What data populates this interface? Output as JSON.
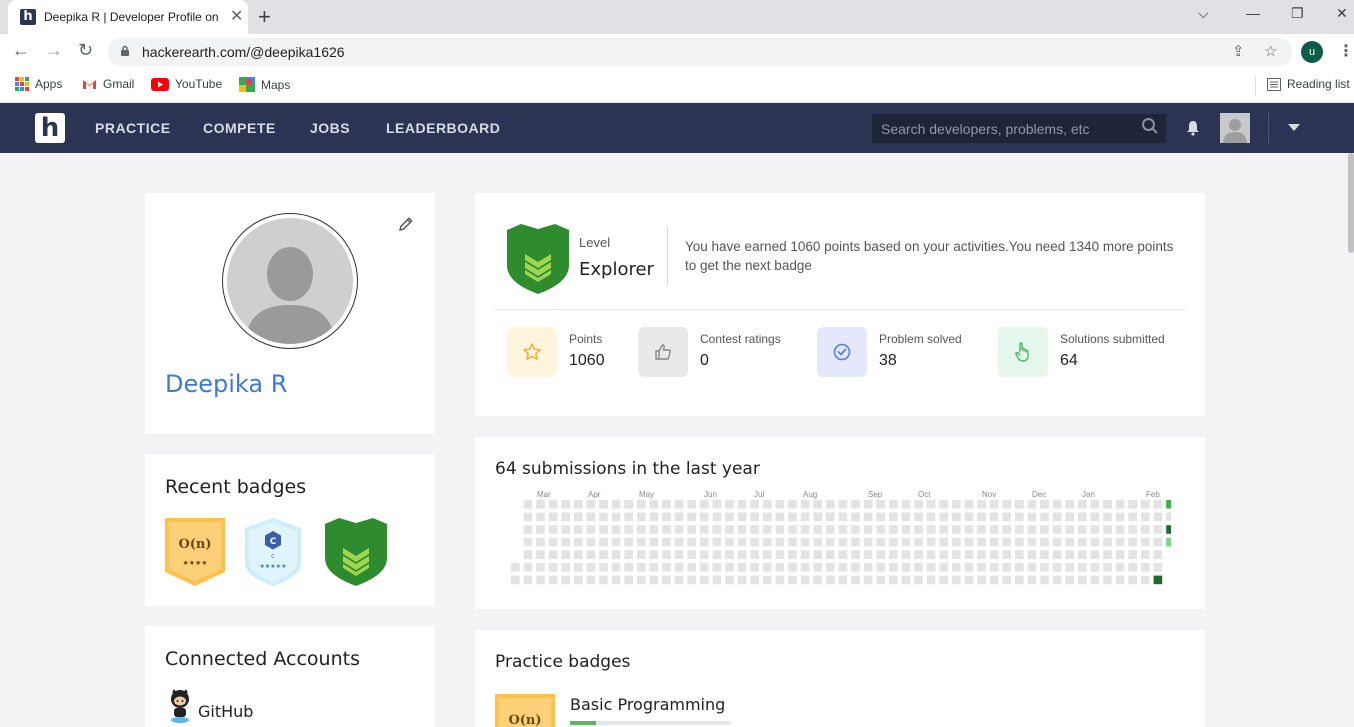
{
  "browser": {
    "tab_title": "Deepika R | Developer Profile on HackerEarth",
    "url": "hackerearth.com/@deepika1626",
    "profile_initial": "u",
    "bookmarks": [
      {
        "label": "Apps",
        "icon": "apps-grid-icon"
      },
      {
        "label": "Gmail",
        "icon": "gmail-icon"
      },
      {
        "label": "YouTube",
        "icon": "youtube-icon"
      },
      {
        "label": "Maps",
        "icon": "maps-icon"
      }
    ],
    "reading_list": "Reading list"
  },
  "nav": {
    "logo": "h",
    "links": [
      "PRACTICE",
      "COMPETE",
      "JOBS",
      "LEADERBOARD"
    ],
    "search_placeholder": "Search developers, problems, etc"
  },
  "profile": {
    "name": "Deepika R"
  },
  "level": {
    "label": "Level",
    "value": "Explorer",
    "message": "You have earned 1060 points based on your activities.You need 1340 more points to get the next badge"
  },
  "stats": [
    {
      "label": "Points",
      "value": "1060",
      "icon": "star-icon",
      "bg": "#fff4dc",
      "color": "#f0b429"
    },
    {
      "label": "Contest ratings",
      "value": "0",
      "icon": "thumbs-up-icon",
      "bg": "#e9e9e9",
      "color": "#888888"
    },
    {
      "label": "Problem solved",
      "value": "38",
      "icon": "check-circle-icon",
      "bg": "#e3e8fb",
      "color": "#5a7be0"
    },
    {
      "label": "Solutions submitted",
      "value": "64",
      "icon": "hand-pointer-icon",
      "bg": "#e5f6ea",
      "color": "#4cb86b"
    }
  ],
  "badges": {
    "title": "Recent badges",
    "items": [
      {
        "name": "O(n)",
        "stars": "★★★★",
        "type": "complexity-badge"
      },
      {
        "name": "C",
        "sub": "C",
        "stars": "★★★★★",
        "type": "c-language-badge"
      },
      {
        "name": "",
        "type": "explorer-badge"
      }
    ]
  },
  "accounts": {
    "title": "Connected Accounts",
    "items": [
      {
        "label": "GitHub",
        "icon": "github-icon"
      }
    ]
  },
  "submissions": {
    "title": "64 submissions in the last year",
    "months": [
      "Mar",
      "Apr",
      "May",
      "Jun",
      "Jul",
      "Aug",
      "Sep",
      "Oct",
      "Nov",
      "Dec",
      "Jan",
      "Feb"
    ]
  },
  "practice": {
    "title": "Practice badges",
    "items": [
      {
        "badge": "O(n)",
        "name": "Basic Programming",
        "progress": 0.16
      }
    ]
  },
  "colors": {
    "nav_bg": "#2c3454",
    "accent_blue": "#3a7bd5",
    "badge_green": "#2e8b2e",
    "heat_empty": "#e3e3e3",
    "heat_light": "#7dd186",
    "heat_mid": "#3bb149",
    "heat_dark": "#1e6b2a"
  }
}
